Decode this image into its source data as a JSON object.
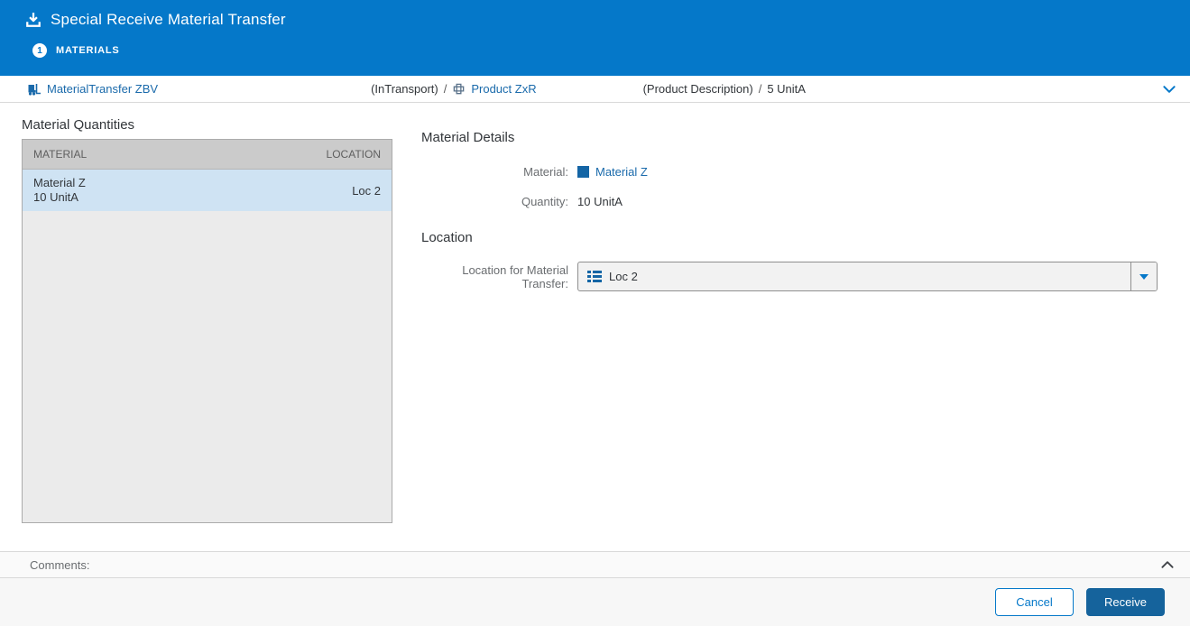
{
  "header": {
    "title": "Special Receive Material Transfer",
    "step": {
      "number": "1",
      "label": "MATERIALS"
    }
  },
  "breadcrumb": {
    "transfer_link": "MaterialTransfer ZBV",
    "status": "(InTransport)",
    "separator1": "/",
    "product_link": "Product ZxR",
    "product_description": "(Product Description)",
    "separator2": "/",
    "quantity": "5 UnitA"
  },
  "material_quantities": {
    "title": "Material Quantities",
    "columns": [
      "MATERIAL",
      "LOCATION"
    ],
    "rows": [
      {
        "material": "Material Z",
        "quantity": "10 UnitA",
        "location": "Loc 2",
        "selected": true
      }
    ]
  },
  "material_details": {
    "title": "Material Details",
    "material_label": "Material:",
    "material_value": "Material Z",
    "quantity_label": "Quantity:",
    "quantity_value": "10 UnitA"
  },
  "location_section": {
    "title": "Location",
    "field_label": "Location for Material Transfer:",
    "selected_value": "Loc 2"
  },
  "comments": {
    "label": "Comments:"
  },
  "footer": {
    "cancel_label": "Cancel",
    "receive_label": "Receive"
  },
  "icons": {
    "header": "download-icon",
    "transfer": "forklift-icon",
    "product": "product-plus-icon",
    "material": "material-square-icon",
    "location": "list-icon",
    "crumb_toggle": "chevron-down-icon",
    "comments_toggle": "chevron-up-icon",
    "select_open": "dropdown-arrow-icon"
  },
  "colors": {
    "header_blue": "#0578c9",
    "receive_blue": "#15639c",
    "selected_row": "#cfe3f3",
    "link_blue": "#1a6aab"
  }
}
